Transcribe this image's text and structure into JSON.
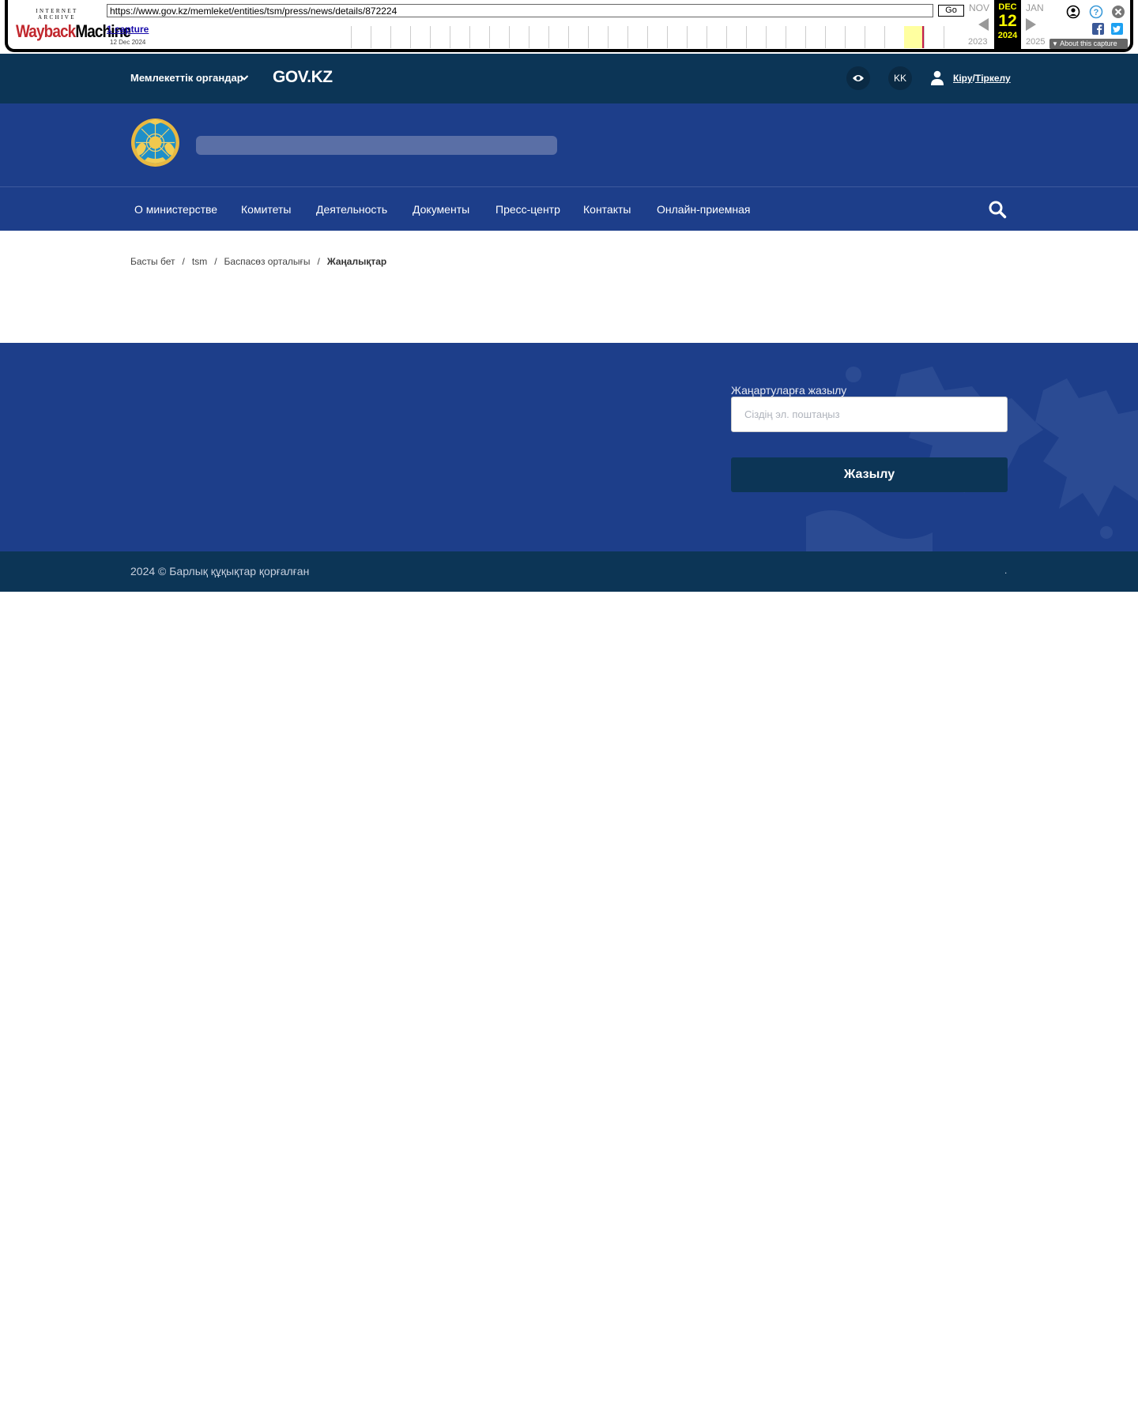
{
  "wayback": {
    "logo_top": "INTERNET ARCHIVE",
    "logo_way": "Wayback",
    "logo_machine": "Machine",
    "url": "https://www.gov.kz/memleket/entities/tsm/press/news/details/872224",
    "go_label": "Go",
    "captures_label": "1 capture",
    "capture_date": "12 Dec 2024",
    "prev_month": "NOV",
    "prev_year": "2023",
    "cur_month": "DEC",
    "cur_day": "12",
    "cur_year": "2024",
    "next_month": "JAN",
    "next_year": "2025",
    "about_label": "About this capture"
  },
  "header": {
    "gov_menu_label": "Мемлекеттік органдар",
    "site_logo": "GOV.KZ",
    "lang_label": "KK",
    "login_label": "Кіру",
    "login_sep": "/",
    "register_label": "Тіркелу"
  },
  "nav": {
    "items": [
      "О министерстве",
      "Комитеты",
      "Деятельность",
      "Документы",
      "Пресс-центр",
      "Контакты",
      "Онлайн-приемная"
    ]
  },
  "breadcrumb": {
    "items": [
      "Басты бет",
      "tsm",
      "Баспасөз орталығы"
    ],
    "separator": "/",
    "current": "Жаңалықтар"
  },
  "subscribe": {
    "label": "Жаңартуларға жазылу",
    "placeholder": "Сіздің эл. поштаңыз",
    "button": "Жазылу"
  },
  "footer": {
    "copyright": "2024 © Барлық құқықтар қорғалған",
    "dot": "."
  },
  "colors": {
    "topbar": "#0c3556",
    "brand_blue": "#1d3e8a",
    "wayback_highlight": "#ffff00"
  }
}
